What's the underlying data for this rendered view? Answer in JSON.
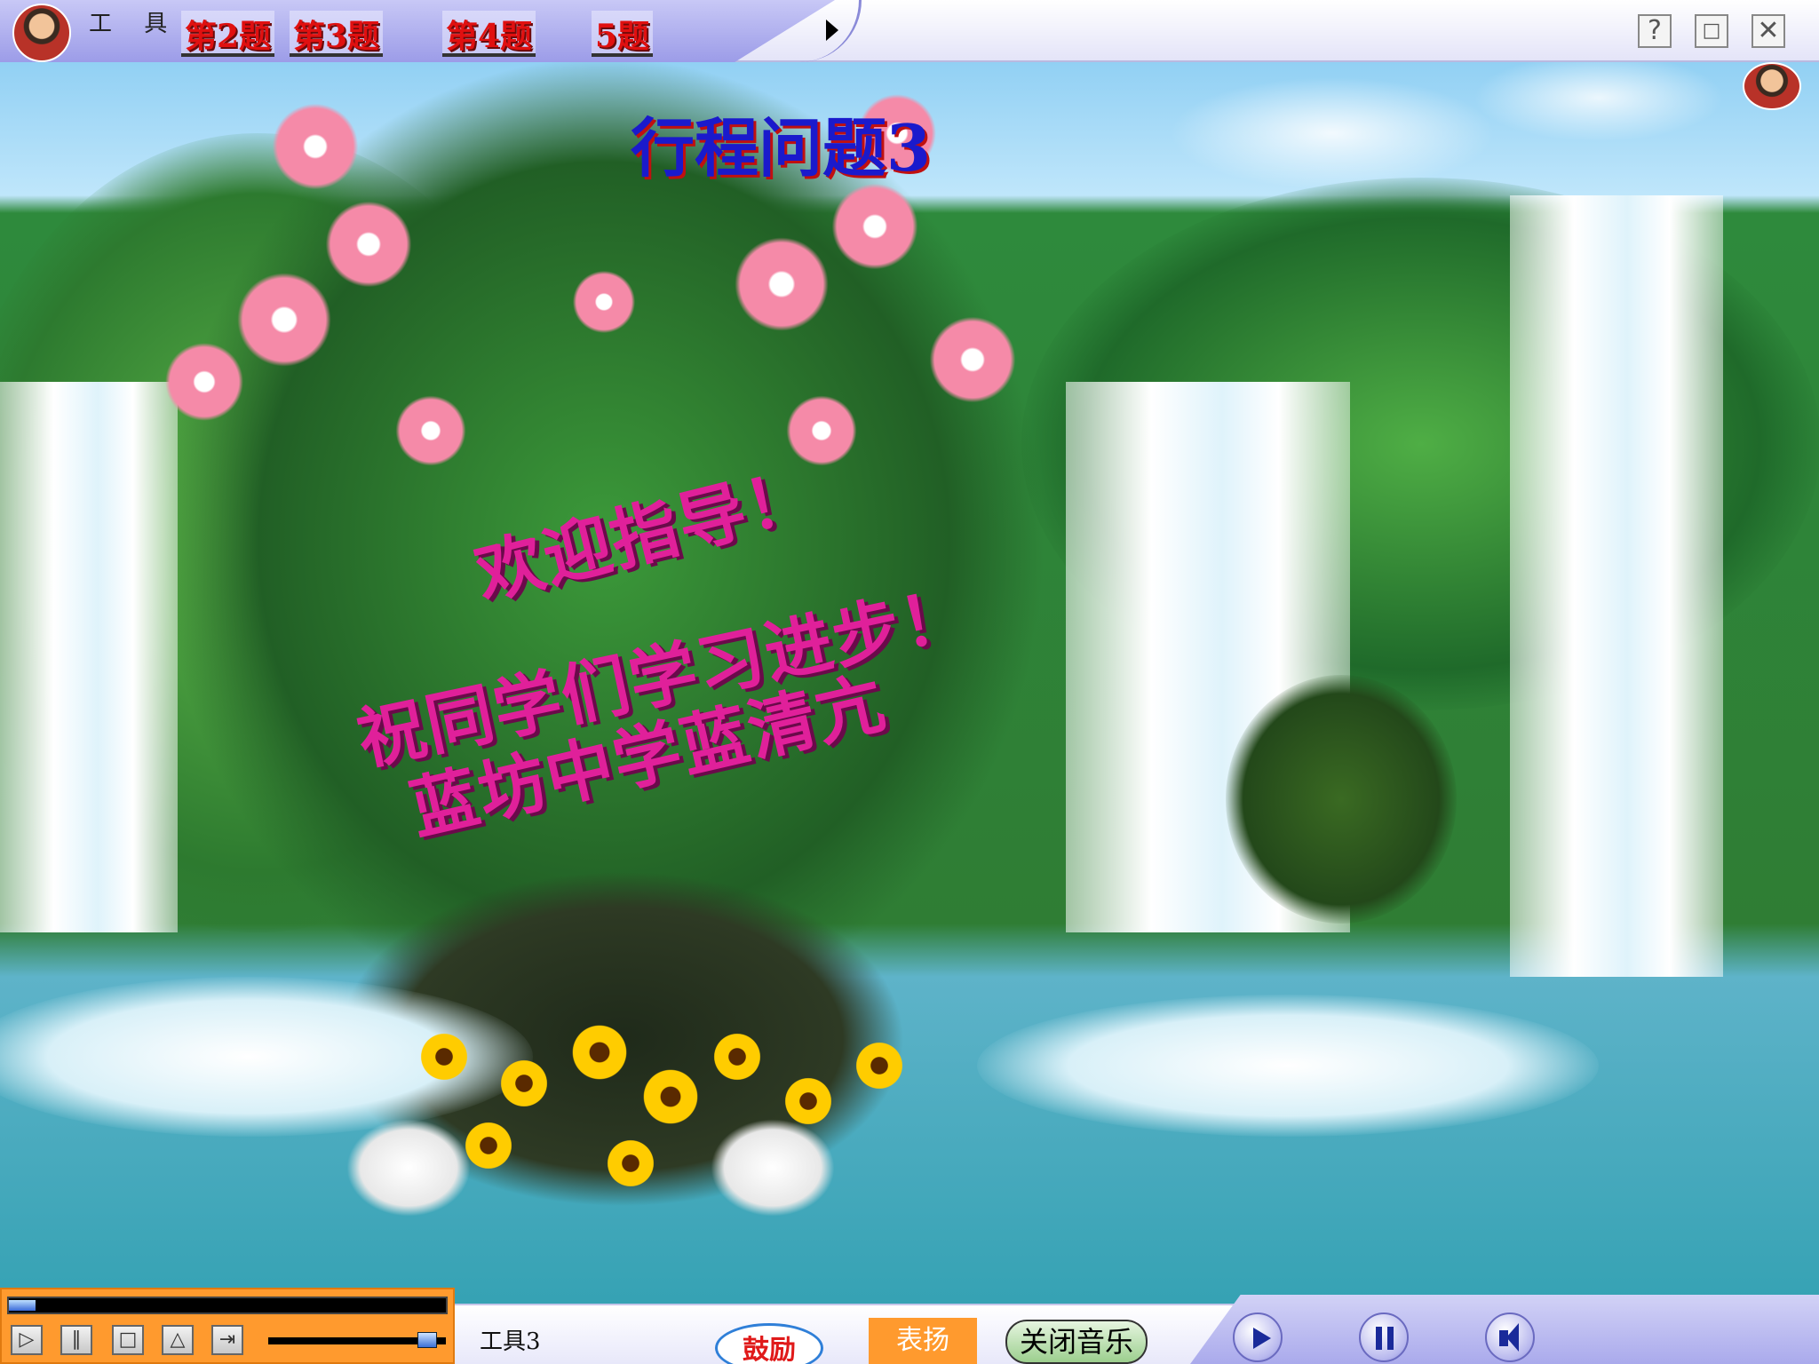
{
  "topbar": {
    "tools_label": "工 具",
    "question_tabs": [
      "第2题",
      "第3题",
      "第4题",
      "5题"
    ],
    "window_buttons": [
      "help-icon",
      "restore-icon",
      "close-icon"
    ]
  },
  "slide": {
    "title": "行程问题3",
    "greeting_line1": "欢迎指导！",
    "greeting_line2": "祝同学们学习进步！",
    "greeting_line3": "蓝坊中学蓝清亢"
  },
  "bottombar": {
    "tool_label": "工具3",
    "encourage_label": "鼓励",
    "praise_label": "表扬",
    "music_label": "关闭音乐",
    "media_progress_fraction": 0.06,
    "volume_fraction": 0.95
  },
  "colors": {
    "title": "#1a1acc",
    "greeting": "#e0209a",
    "tab_text": "#e01010",
    "media_panel": "#ff9a2e"
  }
}
